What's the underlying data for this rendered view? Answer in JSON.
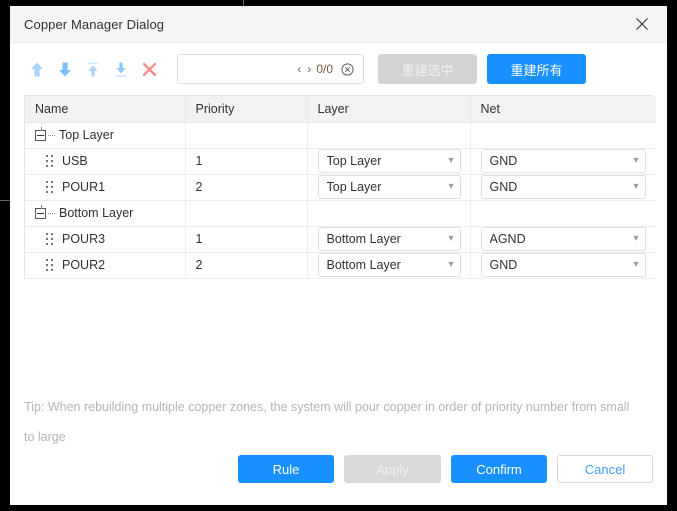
{
  "dialog": {
    "title": "Copper Manager Dialog",
    "close_icon": "close-icon"
  },
  "toolbar": {
    "icons": [
      {
        "name": "move-up-icon",
        "title": "Move Up"
      },
      {
        "name": "move-down-icon",
        "title": "Move Down"
      },
      {
        "name": "move-to-top-icon",
        "title": "Move To Top"
      },
      {
        "name": "move-to-bottom-icon",
        "title": "Move To Bottom"
      },
      {
        "name": "delete-icon",
        "title": "Delete"
      }
    ],
    "search": {
      "value": "",
      "placeholder": "",
      "prev_label": "‹",
      "next_label": "›",
      "count": "0/0",
      "clear_icon": "clear-circle-icon"
    },
    "rebuild_selected_label": "重建选中",
    "rebuild_all_label": "重建所有"
  },
  "table": {
    "columns": [
      "Name",
      "Priority",
      "Layer",
      "Net"
    ],
    "rows": [
      {
        "type": "group",
        "name": "Top Layer",
        "priority": "",
        "layer": "",
        "net": ""
      },
      {
        "type": "child",
        "name": "USB",
        "priority": "1",
        "layer": "Top Layer",
        "net": "GND"
      },
      {
        "type": "child",
        "name": "POUR1",
        "priority": "2",
        "layer": "Top Layer",
        "net": "GND"
      },
      {
        "type": "group",
        "name": "Bottom Layer",
        "priority": "",
        "layer": "",
        "net": ""
      },
      {
        "type": "child",
        "name": "POUR3",
        "priority": "1",
        "layer": "Bottom Layer",
        "net": "AGND"
      },
      {
        "type": "child",
        "name": "POUR2",
        "priority": "2",
        "layer": "Bottom Layer",
        "net": "GND"
      }
    ]
  },
  "tip": "Tip: When rebuilding multiple copper zones, the system will pour copper in order of priority number from small to large",
  "footer": {
    "rule_label": "Rule",
    "apply_label": "Apply",
    "confirm_label": "Confirm",
    "cancel_label": "Cancel"
  },
  "colors": {
    "accent": "#1890ff",
    "disabled": "#d9d9d9",
    "delete": "#f56c6c",
    "arrow_light": "#a0cfff",
    "arrow_dark": "#5cb0ff",
    "count_text": "#7a5c3e",
    "tip_text": "#b5b5b5"
  }
}
